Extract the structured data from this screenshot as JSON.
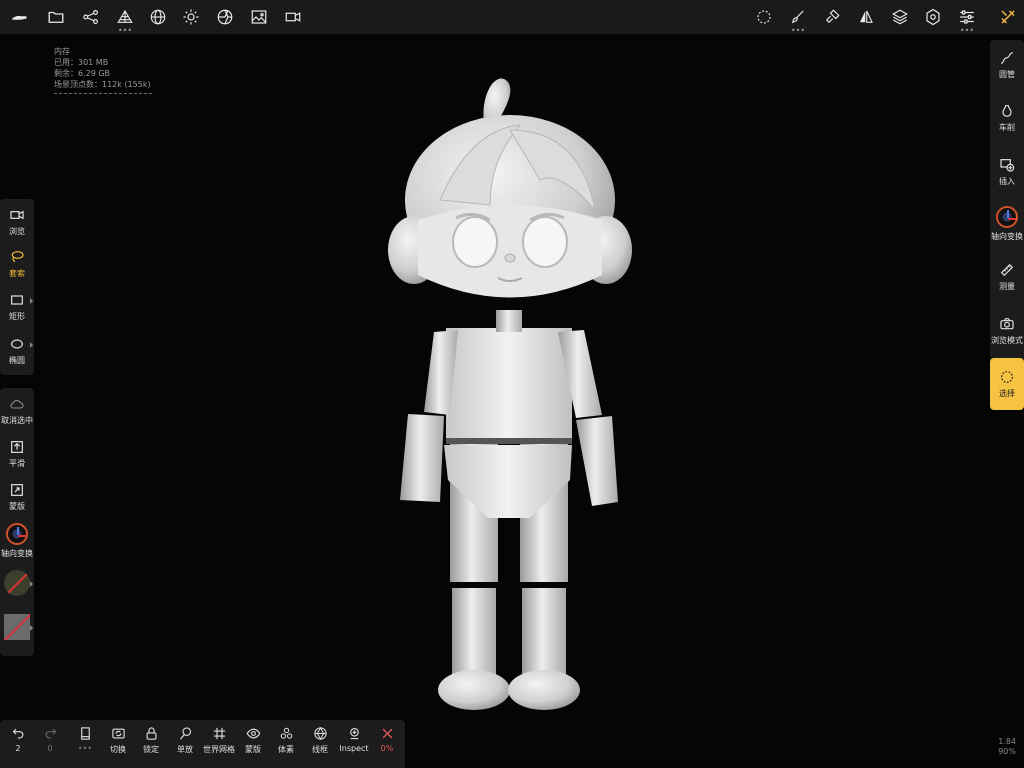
{
  "top_toolbar": {
    "left_icons": [
      "logo-icon",
      "folder-icon",
      "scene-graph-icon",
      "topology-icon",
      "material-sphere-icon",
      "light-sun-icon",
      "shading-icon",
      "image-icon",
      "camera-icon"
    ],
    "right_icons": [
      "selection-dotted-circle-icon",
      "brush-icon",
      "paint-icon",
      "symmetry-icon",
      "layers-icon",
      "settings-gear-icon",
      "sliders-icon",
      "tools-icon"
    ]
  },
  "memory_info": {
    "title": "内存",
    "used": "已用：301 MB",
    "remaining": "剩余：6.29 GB",
    "vertices": "场景顶点数：112k (155k)"
  },
  "left_panel_top": {
    "tools": [
      {
        "label": "浏览",
        "icon": "camera-icon"
      },
      {
        "label": "套索",
        "icon": "lasso-icon",
        "active": true
      },
      {
        "label": "矩形",
        "icon": "rectangle-icon"
      },
      {
        "label": "椭圆",
        "icon": "ellipse-icon"
      }
    ]
  },
  "left_panel_bottom": {
    "tools": [
      {
        "label": "取消选中",
        "icon": "cloud-icon"
      },
      {
        "label": "平滑",
        "icon": "smooth-icon"
      },
      {
        "label": "蒙版",
        "icon": "mask-icon"
      },
      {
        "label": "轴向变换",
        "icon": "gizmo-icon"
      }
    ],
    "swatch_colors": [
      "#3d3f2c",
      "#6b6b6b"
    ]
  },
  "right_panel": {
    "tools": [
      {
        "label": "圆管",
        "icon": "tube-icon"
      },
      {
        "label": "车削",
        "icon": "lathe-icon"
      },
      {
        "label": "插入",
        "icon": "insert-icon"
      },
      {
        "label": "轴向变换",
        "icon": "gizmo-icon"
      },
      {
        "label": "测量",
        "icon": "ruler-icon"
      },
      {
        "label": "浏览模式",
        "icon": "camera-view-icon"
      },
      {
        "label": "选择",
        "icon": "select-icon",
        "active": true
      }
    ],
    "accent": "#f5c242"
  },
  "bottom_toolbar": {
    "undo_count": "2",
    "redo_count": "0",
    "items": [
      {
        "label": "切换",
        "icon": "toggle-icon"
      },
      {
        "label": "锁定",
        "icon": "lock-icon"
      },
      {
        "label": "单放",
        "icon": "isolate-icon"
      },
      {
        "label": "世界网格",
        "icon": "grid-icon"
      },
      {
        "label": "蒙版",
        "icon": "eye-icon"
      },
      {
        "label": "体素",
        "icon": "voxel-icon"
      },
      {
        "label": "线框",
        "icon": "wireframe-icon"
      },
      {
        "label": "Inspect",
        "icon": "inspect-icon"
      }
    ],
    "close_label": "0%"
  },
  "corner_stats": {
    "line1": "1.84",
    "line2": "90%"
  }
}
